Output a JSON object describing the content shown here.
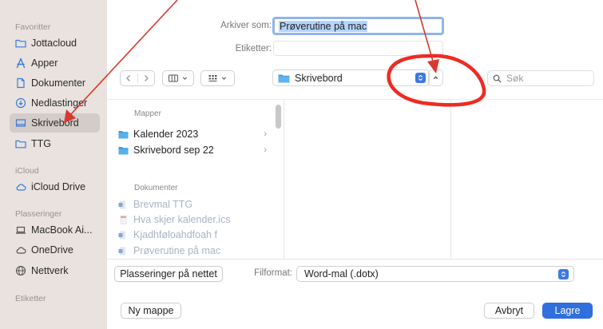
{
  "sidebar": {
    "favorites_header": "Favoritter",
    "favorites": [
      {
        "label": "Jottacloud",
        "icon": "folder-icon"
      },
      {
        "label": "Apper",
        "icon": "applications-icon"
      },
      {
        "label": "Dokumenter",
        "icon": "document-icon"
      },
      {
        "label": "Nedlastinger",
        "icon": "download-icon"
      },
      {
        "label": "Skrivebord",
        "icon": "desktop-icon"
      },
      {
        "label": "TTG",
        "icon": "folder-icon"
      }
    ],
    "icloud_header": "iCloud",
    "icloud": [
      {
        "label": "iCloud Drive",
        "icon": "cloud-icon"
      }
    ],
    "locations_header": "Plasseringer",
    "locations": [
      {
        "label": "MacBook Ai...",
        "icon": "laptop-icon"
      },
      {
        "label": "OneDrive",
        "icon": "cloud-icon"
      },
      {
        "label": "Nettverk",
        "icon": "globe-icon"
      }
    ],
    "tags_header": "Etiketter"
  },
  "save_as": {
    "label": "Arkiver som:",
    "value": "Prøverutine på mac"
  },
  "tags": {
    "label": "Etiketter:",
    "value": ""
  },
  "location_popup": {
    "value": "Skrivebord"
  },
  "search": {
    "placeholder": "Søk"
  },
  "browser": {
    "folders_header": "Mapper",
    "folders": [
      "Kalender 2023",
      "Skrivebord sep 22"
    ],
    "documents_header": "Dokumenter",
    "documents": [
      "Brevmal TTG",
      "Hva skjer kalender.ics",
      "Kjadhføloahdfoah f",
      "Prøverutine på mac"
    ]
  },
  "footer": {
    "online_locations": "Plasseringer på nettet",
    "format_label": "Filformat:",
    "format_value": "Word-mal (.dotx)",
    "new_folder": "Ny mappe",
    "cancel": "Avbryt",
    "save": "Lagre"
  },
  "colors": {
    "accent": "#2f6fde",
    "annotation": "#e8312a",
    "sidebar": "#e9e2de"
  }
}
